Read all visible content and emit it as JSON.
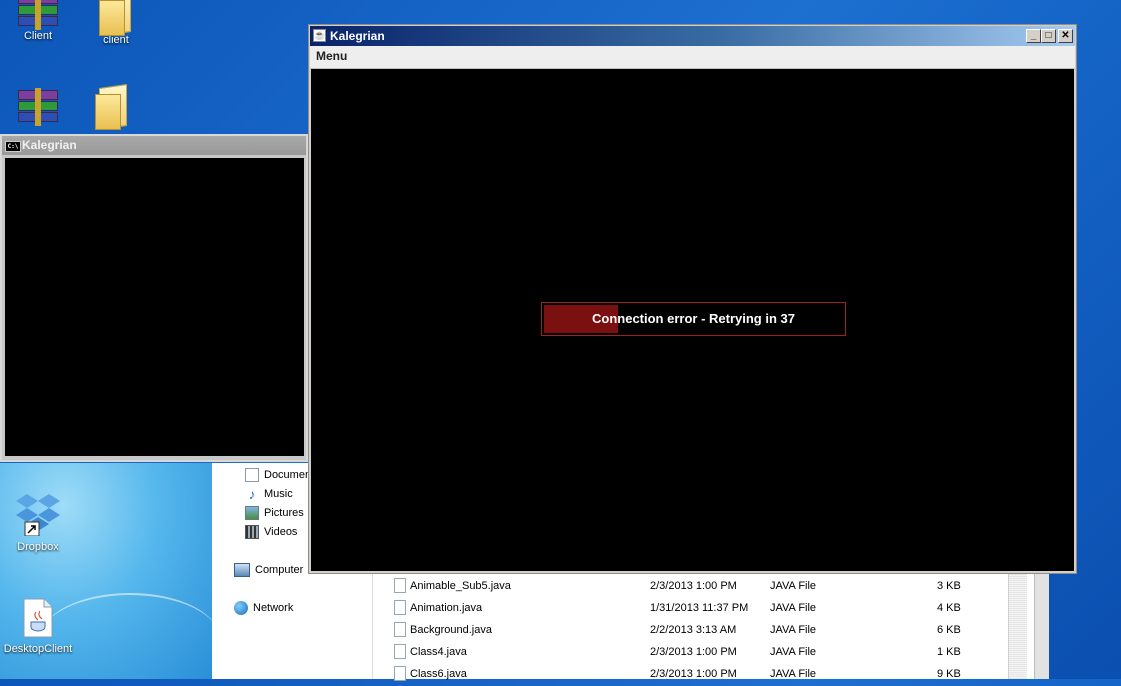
{
  "desktop": {
    "icons": [
      {
        "label": "Client",
        "icon": "winrar-archive-icon"
      },
      {
        "label": "client",
        "icon": "folder-icon"
      },
      {
        "label": "",
        "icon": "winrar-archive-icon"
      },
      {
        "label": "",
        "icon": "folder-icon"
      },
      {
        "label": "Dropbox",
        "icon": "dropbox-shortcut-icon"
      },
      {
        "label": "DesktopClient",
        "icon": "jar-file-icon"
      }
    ]
  },
  "console_window": {
    "title": "Kalegrian",
    "icon": "console-icon",
    "icon_text": "C:\\"
  },
  "explorer": {
    "nav_items": [
      {
        "label": "Documents",
        "icon": "documents-icon"
      },
      {
        "label": "Music",
        "icon": "music-icon"
      },
      {
        "label": "Pictures",
        "icon": "pictures-icon"
      },
      {
        "label": "Videos",
        "icon": "videos-icon"
      },
      {
        "label": "Computer",
        "icon": "computer-icon"
      },
      {
        "label": "Network",
        "icon": "network-icon"
      }
    ],
    "files": [
      {
        "name": "Animable_Sub5.java",
        "date": "2/3/2013 1:00 PM",
        "type": "JAVA File",
        "size": "3 KB"
      },
      {
        "name": "Animation.java",
        "date": "1/31/2013 11:37 PM",
        "type": "JAVA File",
        "size": "4 KB"
      },
      {
        "name": "Background.java",
        "date": "2/2/2013 3:13 AM",
        "type": "JAVA File",
        "size": "6 KB"
      },
      {
        "name": "Class4.java",
        "date": "2/3/2013 1:00 PM",
        "type": "JAVA File",
        "size": "1 KB"
      },
      {
        "name": "Class6.java",
        "date": "2/3/2013 1:00 PM",
        "type": "JAVA File",
        "size": "9 KB"
      }
    ]
  },
  "game_window": {
    "title": "Kalegrian",
    "menu_label": "Menu",
    "minimize": "_",
    "maximize": "□",
    "close": "✕",
    "status_text": "Connection error - Retrying in 37",
    "progress_fraction": 0.25,
    "progress_color": "#7a1010"
  }
}
